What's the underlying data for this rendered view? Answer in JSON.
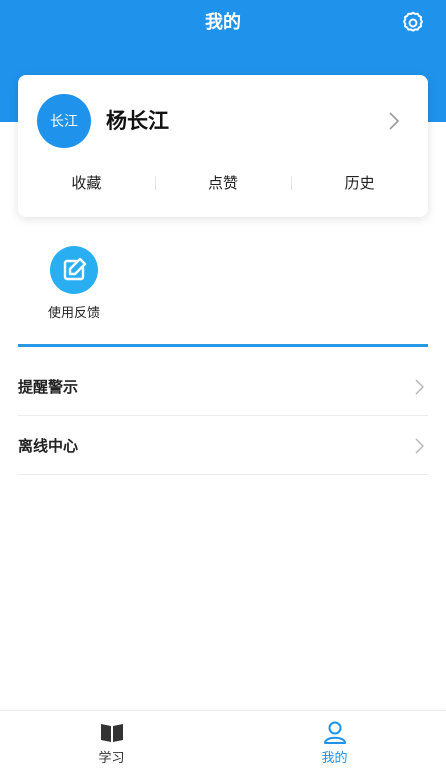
{
  "header": {
    "title": "我的"
  },
  "profile": {
    "avatar_text": "长江",
    "name": "杨长江",
    "stats": [
      {
        "label": "收藏"
      },
      {
        "label": "点赞"
      },
      {
        "label": "历史"
      }
    ]
  },
  "tools": [
    {
      "label": "使用反馈",
      "icon": "edit-icon"
    }
  ],
  "menu": [
    {
      "label": "提醒警示"
    },
    {
      "label": "离线中心"
    }
  ],
  "tabbar": {
    "items": [
      {
        "label": "学习",
        "icon": "book-icon",
        "active": false
      },
      {
        "label": "我的",
        "icon": "user-icon",
        "active": true
      }
    ]
  },
  "colors": {
    "primary": "#1f93ec",
    "feedback_icon_bg": "#2aaef2",
    "divider": "#2599e6",
    "tab_active": "#1f93ec",
    "tab_inactive": "#333333"
  }
}
